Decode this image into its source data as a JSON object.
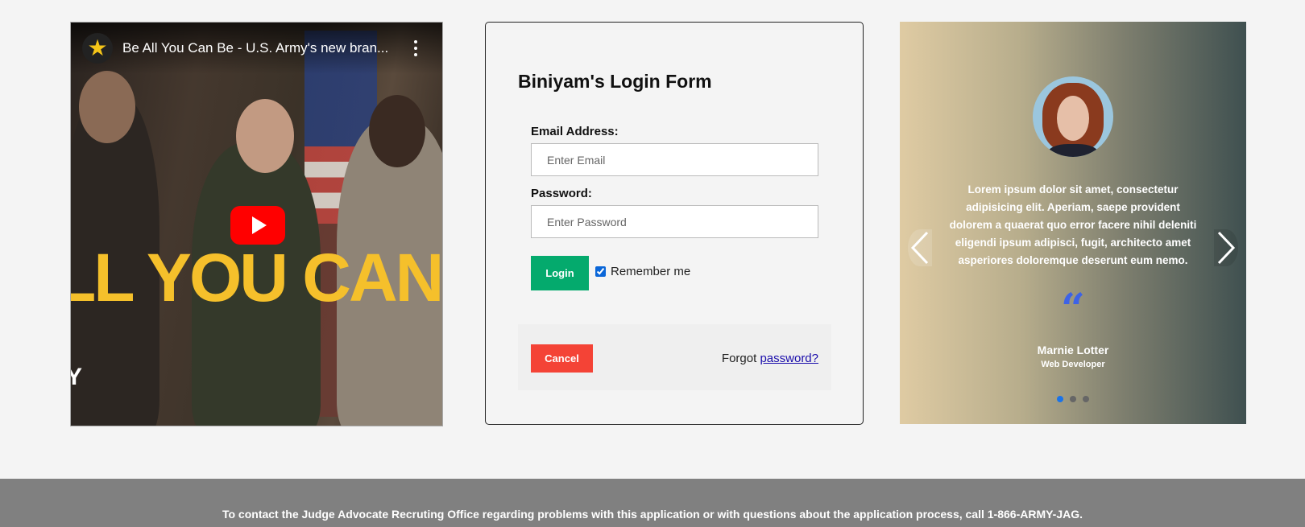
{
  "video": {
    "title": "Be All You Can Be - U.S. Army's new bran...",
    "overlay_text": "LL YOU CAN",
    "overlay_letter": "Y",
    "channel_icon": "star-icon"
  },
  "login": {
    "title": "Biniyam's Login Form",
    "email_label": "Email Address:",
    "email_placeholder": "Enter Email",
    "password_label": "Password:",
    "password_placeholder": "Enter Password",
    "login_button": "Login",
    "remember_label": "Remember me",
    "remember_checked": true,
    "cancel_button": "Cancel",
    "forgot_prefix": "Forgot",
    "forgot_link": "password?"
  },
  "testimonial": {
    "quote": "Lorem ipsum dolor sit amet, consectetur adipisicing elit. Aperiam, saepe provident dolorem a quaerat quo error facere nihil deleniti eligendi ipsum adipisci, fugit, architecto amet asperiores doloremque deserunt eum nemo.",
    "quote_mark": "“",
    "author_name": "Marnie Lotter",
    "author_role": "Web Developer",
    "slides": 3,
    "active_slide": 1,
    "quote_color": "#3d63e6"
  },
  "footer": {
    "text": "To contact the Judge Advocate Recruting Office regarding problems with this application or with questions about the application process, call 1-866-ARMY-JAG."
  },
  "colors": {
    "login_green": "#04aa6d",
    "cancel_red": "#f44336",
    "footer_gray": "#808080",
    "dot_active": "#1a73e8"
  }
}
